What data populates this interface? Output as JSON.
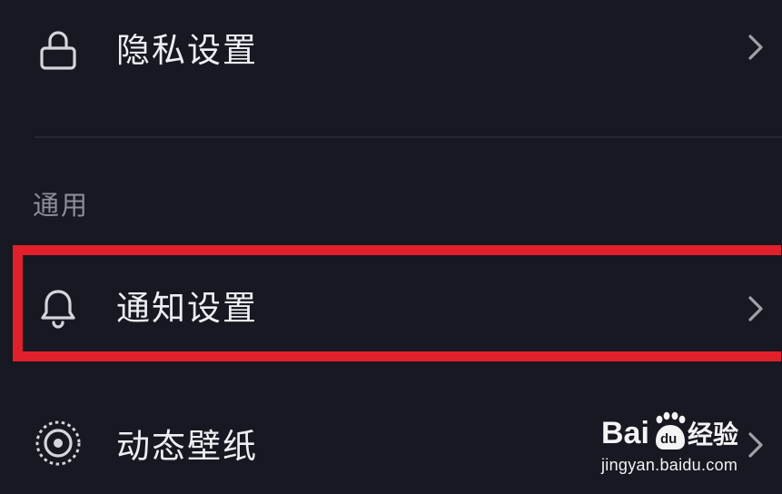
{
  "settings": {
    "privacy": {
      "label": "隐私设置",
      "icon": "lock-icon"
    },
    "section_general": {
      "title": "通用"
    },
    "notifications": {
      "label": "通知设置",
      "icon": "bell-icon"
    },
    "wallpaper": {
      "label": "动态壁纸",
      "icon": "live-wallpaper-icon"
    }
  },
  "watermark": {
    "brand_latin": "Bai",
    "brand_badge": "du",
    "brand_cn": "经验",
    "url": "jingyan.baidu.com"
  },
  "colors": {
    "background": "#171821",
    "text": "#eeeff3",
    "section_text": "#8d8e98",
    "highlight": "#e2202b"
  }
}
